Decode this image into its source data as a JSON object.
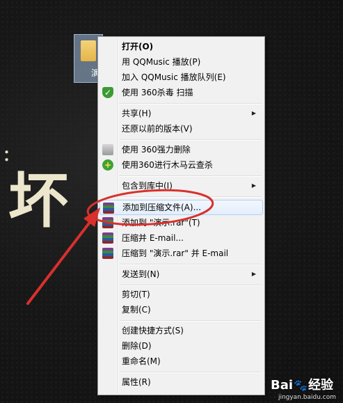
{
  "desktop": {
    "bg_text_colon": "：",
    "bg_text_big": "坏",
    "file_label": "演"
  },
  "menu": {
    "items": [
      {
        "label": "打开(O)",
        "bold": true
      },
      {
        "label": "用 QQMusic 播放(P)"
      },
      {
        "label": "加入 QQMusic 播放队列(E)"
      },
      {
        "label": "使用 360杀毒 扫描",
        "icon": "shield-icon"
      },
      {
        "label": "共享(H)",
        "submenu": true
      },
      {
        "label": "还原以前的版本(V)"
      },
      {
        "label": "使用 360强力删除",
        "icon": "shredder-icon"
      },
      {
        "label": "使用360进行木马云查杀",
        "icon": "trojan-scan-icon"
      },
      {
        "label": "包含到库中(I)",
        "submenu": true
      },
      {
        "label": "添加到压缩文件(A)...",
        "icon": "winrar-icon",
        "highlighted": true
      },
      {
        "label": "添加到 \"演示.rar\"(T)",
        "icon": "winrar-icon"
      },
      {
        "label": "压缩并 E-mail...",
        "icon": "winrar-icon"
      },
      {
        "label": "压缩到 \"演示.rar\" 并 E-mail",
        "icon": "winrar-icon"
      },
      {
        "label": "发送到(N)",
        "submenu": true
      },
      {
        "label": "剪切(T)"
      },
      {
        "label": "复制(C)"
      },
      {
        "label": "创建快捷方式(S)"
      },
      {
        "label": "删除(D)"
      },
      {
        "label": "重命名(M)"
      },
      {
        "label": "属性(R)"
      }
    ]
  },
  "annotation": {
    "ellipse_color": "#d9302c",
    "arrow_color": "#d9302c"
  },
  "watermark": {
    "brand_a": "Bai",
    "brand_b": "经验",
    "sub": "jingyan.baidu.com"
  }
}
